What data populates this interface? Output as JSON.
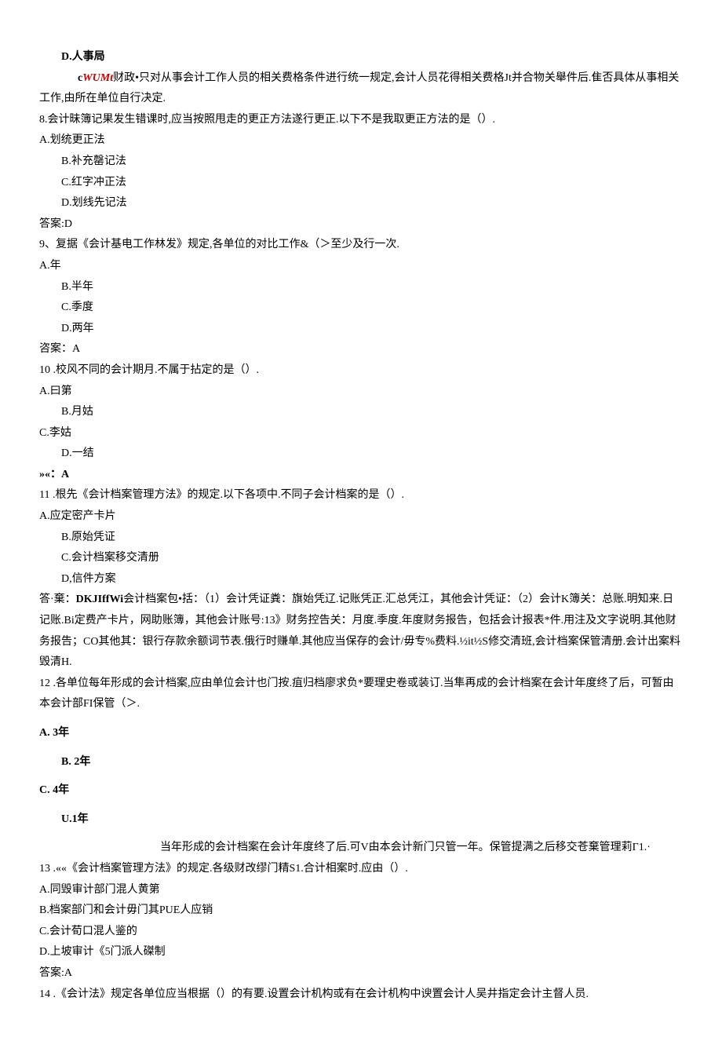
{
  "q7": {
    "optD": "D.人事局",
    "ans_prefix": "c",
    "ans_red": "WUMt",
    "ans_tail": "财政•只对从事会计工作人员的相关费格条件进行统一规定,会计人员花得相关费格Jt并合物关舉件后.隹否具体从事相关工作,由所在单位自行决定."
  },
  "q8": {
    "stem": "8.会计昧簿记果发生错课时,应当按照甩走的更正方法遂行更正.以下不是我取更正方法的是（）.",
    "optA": "A.划统更正法",
    "optB": "B.补充罄记法",
    "optC": "C.红字冲正法",
    "optD": "D.划线先记法",
    "ans": "答案:D"
  },
  "q9": {
    "stem": "9、复据《会计基电工作林发》规定,各单位的对比工作&（＞至少及行一次.",
    "optA": "A.年",
    "optB": "B.半年",
    "optC": "C.季度",
    "optD": "D.两年",
    "ans": "咨案：A"
  },
  "q10": {
    "stem": "10 .校风不同的会计期月.不属于拈定的是（）.",
    "optA": "A.曰第",
    "optB": "B.月姑",
    "optC": "C.李姑",
    "optD": "D.一结",
    "ans": "»«：A"
  },
  "q11": {
    "stem": "11 .根先《会计档案管理方法》的规定.以下各项中.不同子会计档案的是（）.",
    "optA": "A.应定密产卡片",
    "optB": "B.原始凭证",
    "optC": "C.会计档案移交清册",
    "optD": "D,信件方案",
    "ans_p1": "答·棄：",
    "ans_red": "DKJIffWi",
    "ans_p2": "会计档案包•括：（1）会计凭证粪：旗始凭辽.记账凭正.汇总凭江，其他会计凭证：（2）会计K簿关：总账.明知来.日记账.Bi定费产卡片，网助账簿，其他会计账号:13》财务控告关：月度.季度.年度财务报告，包括会计报表*件.用注及文字说明.其他财务报告；CO其他其：银行存款余额词节表.俄行时赚单.其他应当保存的会计/毋专%费料.½it½S修交清班,会计档案保管清册.会计出案料毁清H."
  },
  "q12": {
    "stem": "12  .各单位每年形成的会计档案,应由单位会计也门按.疽归档廖求负*要理史卷或装订.当隼再成的会计档案在会计年度终了后，可暂由本会计部FI保管（＞.",
    "optA": "A.  3年",
    "optB": "B.  2年",
    "optC": "C.  4年",
    "optD": "U.1年",
    "ans": "当年形成的会计档案在会计年度终了后.可V由本会计新门只管一年。保管提满之后移交苍棄管理莉Γ1.·"
  },
  "q13": {
    "stem": "13 .««《会计档案管理方法》的规定.各级财改缪门精S1.合计相案时.应由（）.",
    "optA": "A.同毁审计部门混人黄第",
    "optB": "B.档案部门和会计毋门其PUE人应销",
    "optC": "C.会计荀口混人鉴的",
    "optD": "D.上坡审计《5门派人磔制",
    "ans": "答案:A"
  },
  "q14": {
    "stem": "14 .《会计法》规定各单位应当根据（）的有要.设置会计机构或有在会计机构中谀置会计人吴井指定会计主督人员."
  }
}
